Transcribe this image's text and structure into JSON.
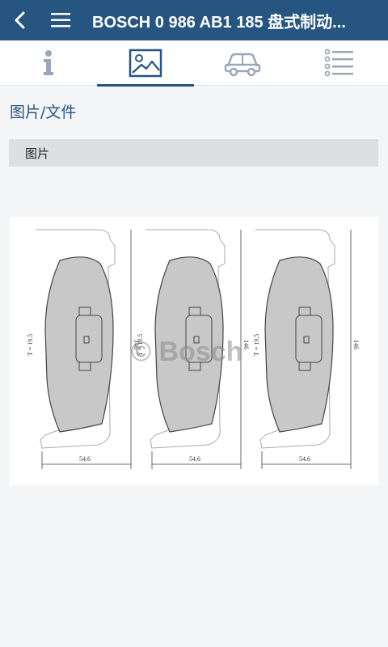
{
  "header": {
    "title": "BOSCH 0 986 AB1 185 盘式制动...",
    "back_icon": "back-arrow-icon",
    "menu_icon": "hamburger-menu-icon"
  },
  "tabs": [
    {
      "icon": "info-icon",
      "active": false
    },
    {
      "icon": "image-icon",
      "active": true
    },
    {
      "icon": "car-icon",
      "active": false
    },
    {
      "icon": "list-icon",
      "active": false
    }
  ],
  "section_title": "图片/文件",
  "subheader": "图片",
  "drawing": {
    "thickness_label": "T = 19.5",
    "height_label": "146",
    "width_label": "54.6",
    "watermark": "© Bosch"
  },
  "colors": {
    "primary": "#255580",
    "tab_icon_inactive": "#9aa7b8",
    "pad_fill": "#c8c8c8"
  }
}
